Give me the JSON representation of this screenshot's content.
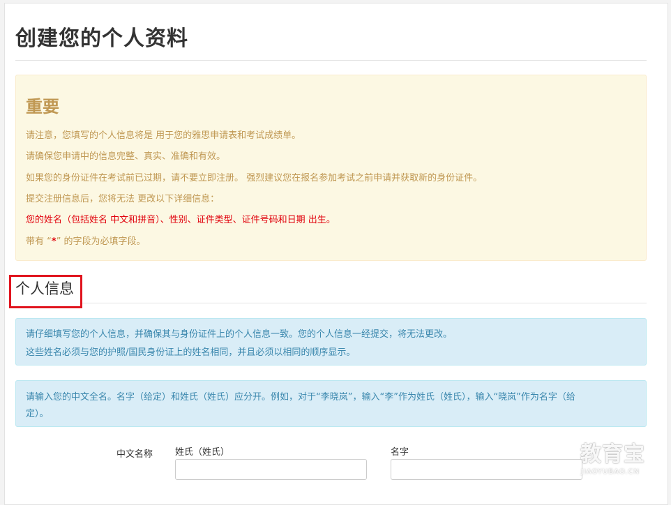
{
  "page": {
    "title": "创建您的个人资料"
  },
  "important": {
    "heading": "重要",
    "lines": [
      "请注意，您填写的个人信息将是 用于您的雅思申请表和考试成绩单。",
      "请确保您申请中的信息完整、真实、准确和有效。",
      "如果您的身份证件在考试前已过期，请不要立即注册。 强烈建议您在报名参加考试之前申请并获取新的身份证件。",
      "提交注册信息后，您将无法 更改以下详细信息：",
      "您的姓名（包括姓名 中文和拼音）、性别、证件类型、证件号码和日期 出生。"
    ],
    "required_prefix": "带有 “",
    "required_star": "*",
    "required_suffix": "” 的字段为必填字段。"
  },
  "personal_info": {
    "heading": "个人信息",
    "notice_1": [
      "请仔细填写您的个人信息，并确保其与身份证件上的个人信息一致。您的个人信息一经提交，将无法更改。",
      "这些姓名必须与您的护照/国民身份证上的姓名相同，并且必须以相同的顺序显示。"
    ],
    "notice_2": [
      "请输入您的中文全名。名字（给定）和姓氏（姓氏）应分开。例如，对于“李晓岚”，输入“李”作为姓氏（姓氏），输入“晓岚”作为名字（给",
      "定）。"
    ]
  },
  "form": {
    "chinese_name_label": "中文名称",
    "surname_label": "姓氏（姓氏）",
    "surname_value": "",
    "given_name_label": "名字",
    "given_name_value": ""
  },
  "watermark": {
    "brand": "教育宝",
    "url": "JIAOYUBAO.CN"
  },
  "colors": {
    "warning_text": "#c09853",
    "warning_bg": "#fcf8e3",
    "info_text": "#3a87ad",
    "info_bg": "#d9edf7",
    "highlight_red": "#e0000b",
    "annotation_box": "#e0141e"
  }
}
